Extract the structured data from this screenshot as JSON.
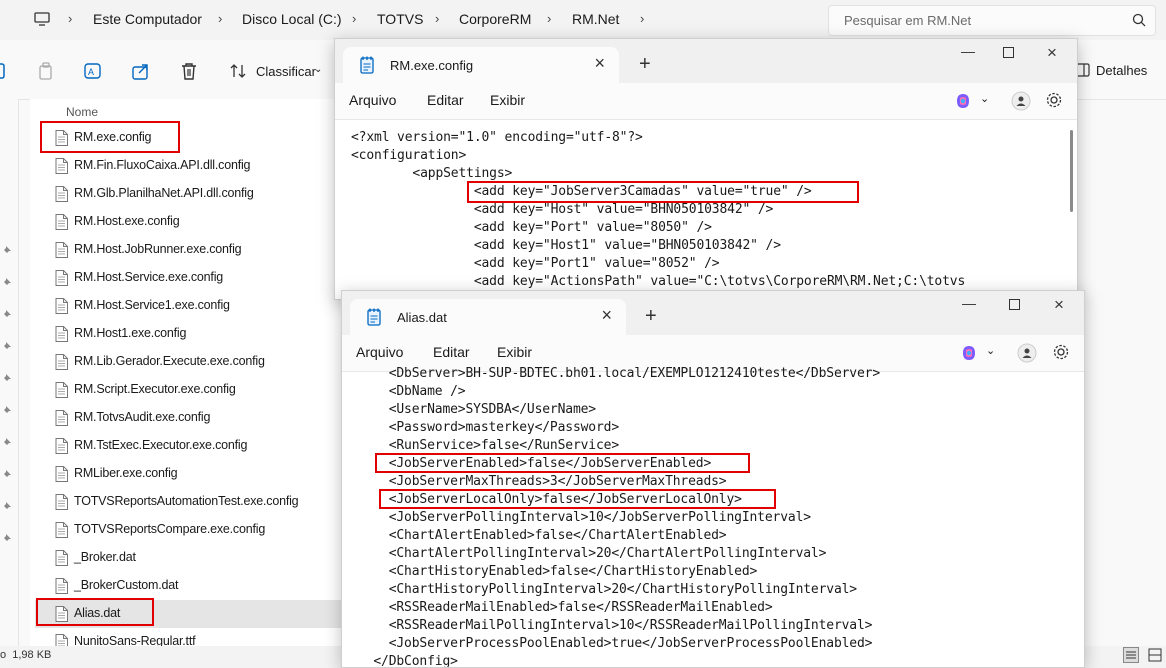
{
  "explorer": {
    "breadcrumb": [
      "Este Computador",
      "Disco Local (C:)",
      "TOTVS",
      "CorporeRM",
      "RM.Net"
    ],
    "search_placeholder": "Pesquisar em RM.Net",
    "toolbar": {
      "sort_label": "Classificar",
      "details_label": "Detalhes"
    },
    "column_name": "Nome",
    "files": [
      "RM.exe.config",
      "RM.Fin.FluxoCaixa.API.dll.config",
      "RM.Glb.PlanilhaNet.API.dll.config",
      "RM.Host.exe.config",
      "RM.Host.JobRunner.exe.config",
      "RM.Host.Service.exe.config",
      "RM.Host.Service1.exe.config",
      "RM.Host1.exe.config",
      "RM.Lib.Gerador.Execute.exe.config",
      "RM.Script.Executor.exe.config",
      "RM.TotvsAudit.exe.config",
      "RM.TstExec.Executor.exe.config",
      "RMLiber.exe.config",
      "TOTVSReportsAutomationTest.exe.config",
      "TOTVSReportsCompare.exe.config",
      "_Broker.dat",
      "_BrokerCustom.dat",
      "Alias.dat",
      "NunitoSans-Regular.ttf"
    ],
    "status": "o  1,98 KB"
  },
  "notepad1": {
    "tab_title": "RM.exe.config",
    "menu": [
      "Arquivo",
      "Editar",
      "Exibir"
    ],
    "lines": [
      "<?xml version=\"1.0\" encoding=\"utf-8\"?>",
      "<configuration>",
      "        <appSettings>",
      "                <add key=\"JobServer3Camadas\" value=\"true\" />",
      "                <add key=\"Host\" value=\"BHN050103842\" />",
      "                <add key=\"Port\" value=\"8050\" />",
      "                <add key=\"Host1\" value=\"BHN050103842\" />",
      "                <add key=\"Port1\" value=\"8052\" />",
      "                <add key=\"ActionsPath\" value=\"C:\\totvs\\CorporeRM\\RM.Net;C:\\totvs"
    ]
  },
  "notepad2": {
    "tab_title": "Alias.dat",
    "menu": [
      "Arquivo",
      "Editar",
      "Exibir"
    ],
    "lines": [
      "    <DbServer>BH-SUP-BDTEC.bh01.local/EXEMPLO1212410teste</DbServer>",
      "    <DbName />",
      "    <UserName>SYSDBA</UserName>",
      "    <Password>masterkey</Password>",
      "    <RunService>false</RunService>",
      "    <JobServerEnabled>false</JobServerEnabled>",
      "    <JobServerMaxThreads>3</JobServerMaxThreads>",
      "    <JobServerLocalOnly>false</JobServerLocalOnly>",
      "    <JobServerPollingInterval>10</JobServerPollingInterval>",
      "    <ChartAlertEnabled>false</ChartAlertEnabled>",
      "    <ChartAlertPollingInterval>20</ChartAlertPollingInterval>",
      "    <ChartHistoryEnabled>false</ChartHistoryEnabled>",
      "    <ChartHistoryPollingInterval>20</ChartHistoryPollingInterval>",
      "    <RSSReaderMailEnabled>false</RSSReaderMailEnabled>",
      "    <RSSReaderMailPollingInterval>10</RSSReaderMailPollingInterval>",
      "    <JobServerProcessPoolEnabled>true</JobServerProcessPoolEnabled>",
      "  </DbConfig>"
    ]
  },
  "colors": {
    "highlight": "#e00000",
    "selected_row": "#e5e5e5",
    "accent": "#0067c0"
  },
  "icons": [
    "computer-icon",
    "search-icon",
    "copy-icon",
    "rename-icon",
    "share-icon",
    "trash-icon",
    "sort-icon",
    "details-icon",
    "notepad-icon",
    "copilot-icon",
    "user-icon",
    "gear-icon",
    "file-icon",
    "pin-icon"
  ]
}
